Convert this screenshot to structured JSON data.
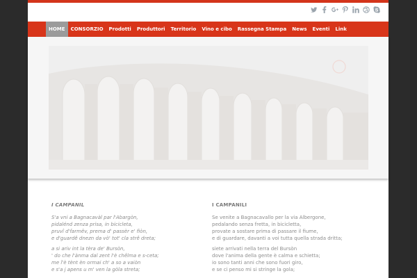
{
  "social": {
    "icons": [
      "twitter-icon",
      "facebook-icon",
      "google-plus-icon",
      "pinterest-icon",
      "linkedin-icon",
      "dribbble-icon",
      "skype-icon"
    ],
    "color": "#9aa4ad"
  },
  "nav": {
    "bg_color": "#d8351a",
    "active_color": "#9b9b9b",
    "items": [
      {
        "label": "HOME",
        "active": true
      },
      {
        "label": "CONSORZIO"
      },
      {
        "label": "Prodotti"
      },
      {
        "label": "Produttori"
      },
      {
        "label": "Territorio"
      },
      {
        "label": "Vino e cibo"
      },
      {
        "label": "Rassegna Stampa"
      },
      {
        "label": "News"
      },
      {
        "label": "Eventi"
      },
      {
        "label": "Link"
      }
    ]
  },
  "poem_dialect": {
    "title": "I CAMPANIL",
    "stanzas": [
      [
        "S'a vni a Bagnacavàl par l'Abargòn,",
        "pidalénd zenza prisa, in bicicleta,",
        "pruvî d'farmêv, prema d' passèr e' fiòn,",
        "e d'guardê dnezn da vò' tot' cla strê dreta;"
      ],
      [
        "a si ariv int la tèra de' Bursòn,",
        "' do che l'ànma dal zent l'è chêlma e s-ceta;",
        "me î'è tènt èn ormai ch' a so a vaiòn",
        "e s'a j apens u m' ven la gòla streta;"
      ]
    ]
  },
  "poem_italian": {
    "title": "I CAMPANILI",
    "stanzas": [
      [
        "Se venite a Bagnacavallo per la via Albergone,",
        "pedalando senza fretta, in bicicletta,",
        "provate a sostare prima di passare il fiume,",
        "e di guardare, davanti a voi tutta quella strada dritta;"
      ],
      [
        "siete arrivati nella terra del Bursòn",
        "dove l'anima della gente è calma e schietta;",
        "io sono tanti anni che sono fuori giro,",
        "e se ci penso mi si stringe la gola;"
      ]
    ]
  }
}
